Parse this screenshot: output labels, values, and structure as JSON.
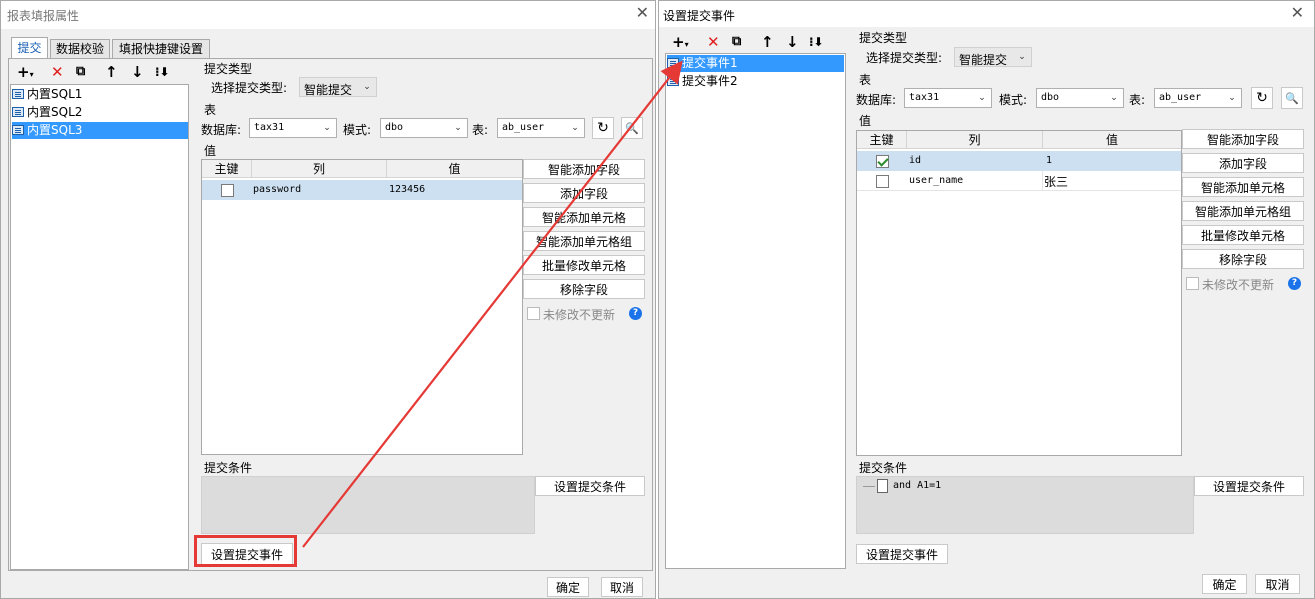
{
  "left_dialog": {
    "title": "报表填报属性",
    "tabs": [
      "提交",
      "数据校验",
      "填报快捷键设置"
    ],
    "tree_items": [
      "内置SQL1",
      "内置SQL2",
      "内置SQL3"
    ],
    "submit_type_section": "提交类型",
    "select_submit_type_label": "选择提交类型:",
    "submit_type_value": "智能提交",
    "table_section": "表",
    "database_label": "数据库:",
    "database_value": "tax31",
    "schema_label": "模式:",
    "schema_value": "dbo",
    "table_label": "表:",
    "table_value": "ab_user",
    "value_section": "值",
    "columns": [
      "主键",
      "列",
      "值"
    ],
    "rows": [
      {
        "key": false,
        "column": "password",
        "value": "123456"
      }
    ],
    "side_buttons": [
      "智能添加字段",
      "添加字段",
      "智能添加单元格",
      "智能添加单元格组",
      "批量修改单元格",
      "移除字段"
    ],
    "no_update_label": "未修改不更新",
    "condition_section": "提交条件",
    "set_condition_button": "设置提交条件",
    "set_event_button": "设置提交事件",
    "ok_button": "确定",
    "cancel_button": "取消"
  },
  "right_dialog": {
    "title": "设置提交事件",
    "tree_items": [
      "提交事件1",
      "提交事件2"
    ],
    "submit_type_section": "提交类型",
    "select_submit_type_label": "选择提交类型:",
    "submit_type_value": "智能提交",
    "table_section": "表",
    "database_label": "数据库:",
    "database_value": "tax31",
    "schema_label": "模式:",
    "schema_value": "dbo",
    "table_label": "表:",
    "table_value": "ab_user",
    "value_section": "值",
    "columns": [
      "主键",
      "列",
      "值"
    ],
    "rows": [
      {
        "key": true,
        "column": "id",
        "value": "1"
      },
      {
        "key": false,
        "column": "user_name",
        "value": "张三"
      }
    ],
    "side_buttons": [
      "智能添加字段",
      "添加字段",
      "智能添加单元格",
      "智能添加单元格组",
      "批量修改单元格",
      "移除字段"
    ],
    "no_update_label": "未修改不更新",
    "condition_section": "提交条件",
    "condition_text": "and A1=1",
    "set_condition_button": "设置提交条件",
    "set_event_button": "设置提交事件",
    "ok_button": "确定",
    "cancel_button": "取消"
  },
  "colors": {
    "highlight": "#e53935",
    "selection": "#3399ff",
    "row_selected": "#cce0f2"
  }
}
